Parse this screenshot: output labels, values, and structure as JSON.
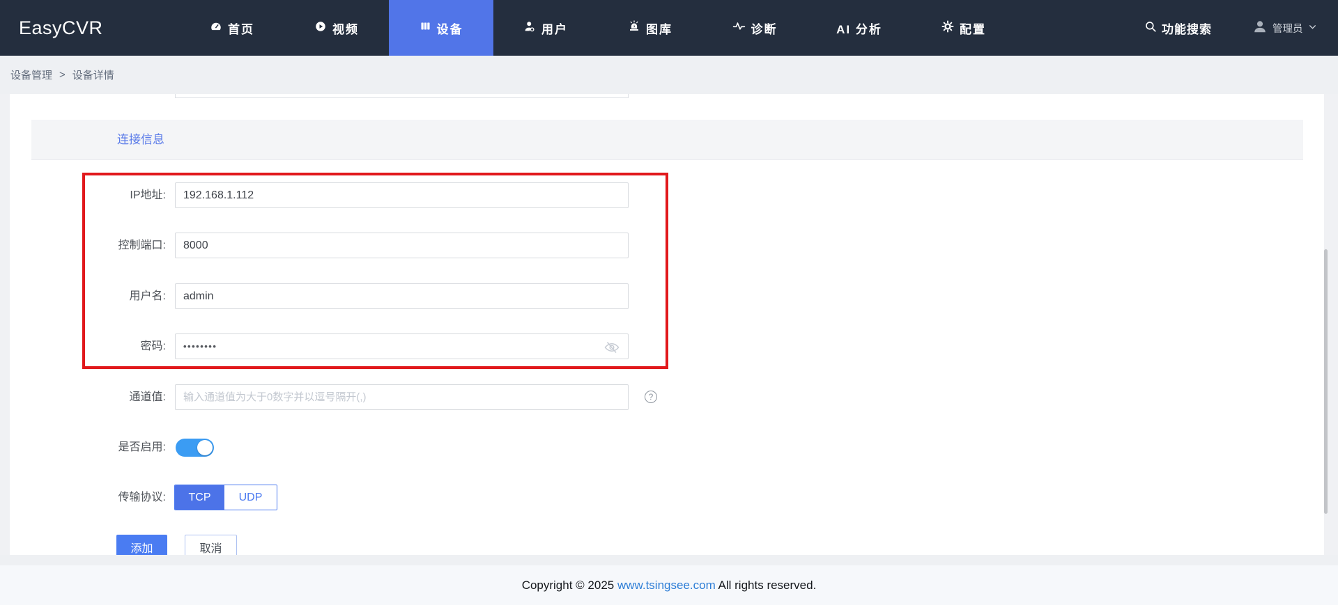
{
  "nav": {
    "logo": "EasyCVR",
    "items": [
      {
        "label": "首页",
        "icon": "dashboard-icon"
      },
      {
        "label": "视频",
        "icon": "play-circle-icon"
      },
      {
        "label": "设备",
        "icon": "device-icon",
        "active": true
      },
      {
        "label": "用户",
        "icon": "user-icon"
      },
      {
        "label": "图库",
        "icon": "alarm-beacon-icon"
      },
      {
        "label": "诊断",
        "icon": "pulse-icon"
      },
      {
        "label": "AI 分析",
        "icon": null
      },
      {
        "label": "配置",
        "icon": "gear-icon"
      }
    ],
    "search_label": "功能搜索",
    "user_label": "管理员"
  },
  "breadcrumb": {
    "items": [
      "设备管理",
      "设备详情"
    ],
    "separator": ">"
  },
  "section": {
    "title": "连接信息"
  },
  "form": {
    "rows": [
      {
        "label": "IP地址:",
        "value": "192.168.1.112",
        "placeholder": ""
      },
      {
        "label": "控制端口:",
        "value": "8000",
        "placeholder": ""
      },
      {
        "label": "用户名:",
        "value": "admin",
        "placeholder": ""
      },
      {
        "label": "密码:",
        "value": "••••••••",
        "masked": true
      },
      {
        "label": "通道值:",
        "value": "",
        "placeholder": "输入通道值为大于0数字并以逗号隔开(,)"
      }
    ],
    "enable": {
      "label": "是否启用:",
      "state": "on"
    },
    "protocol": {
      "label": "传输协议:",
      "options": [
        "TCP",
        "UDP"
      ],
      "selected": "TCP"
    },
    "buttons": {
      "submit": "添加",
      "cancel": "取消"
    },
    "help_glyph": "?"
  },
  "footer": {
    "prefix": "Copyright © 2025 ",
    "link": "www.tsingsee.com",
    "suffix": " All rights reserved."
  },
  "colors": {
    "nav_bg": "#242e3e",
    "active_tab": "#5175e8",
    "section_title": "#5b7ce9",
    "toggle_on": "#3b9cf3",
    "tcp_selected": "#4c73e8",
    "annotation_red": "#e1191c",
    "footer_link": "#2e7ed6"
  }
}
